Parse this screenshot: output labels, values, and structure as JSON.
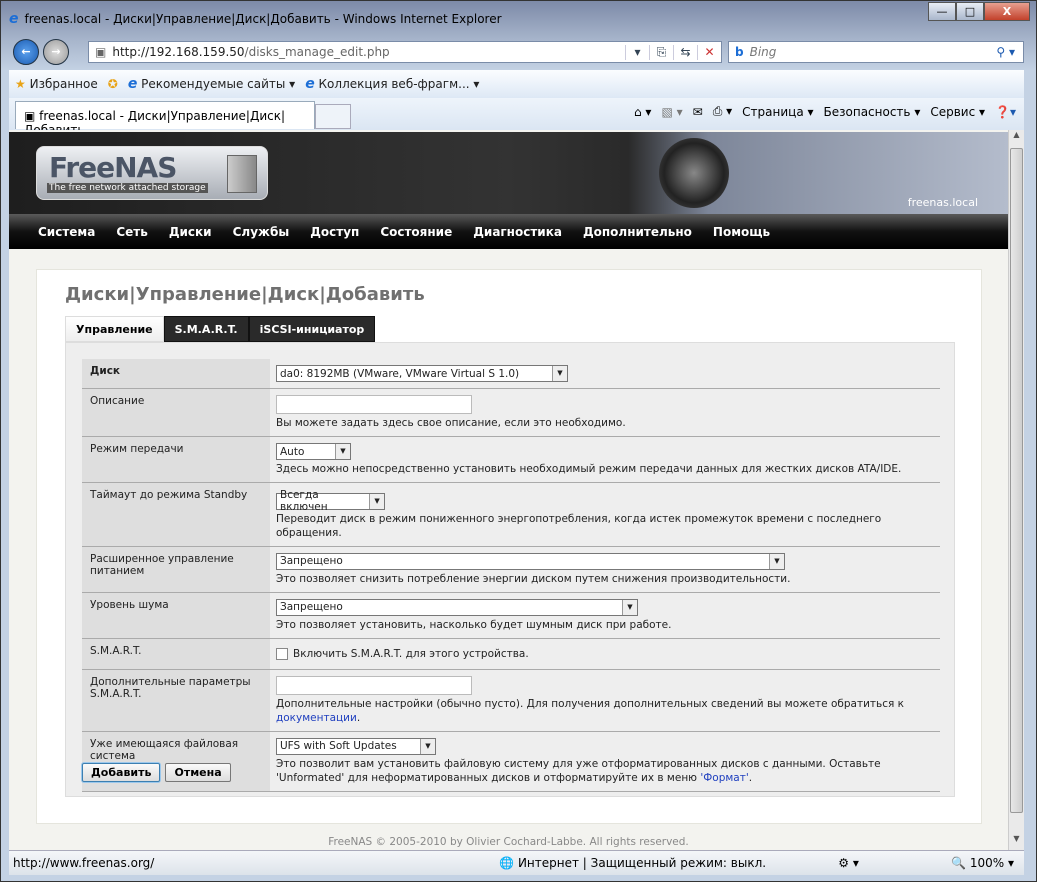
{
  "window": {
    "title": "freenas.local - Диски|Управление|Диск|Добавить - Windows Internet Explorer"
  },
  "browser": {
    "url_host": "http://192.168.159.50",
    "url_path": "/disks_manage_edit.php",
    "search_placeholder": "Bing",
    "favorites_label": "Избранное",
    "fav_links": [
      "Рекомендуемые сайты ▾",
      "Коллекция веб-фрагм... ▾"
    ],
    "tab_title": "freenas.local - Диски|Управление|Диск|Добавить",
    "commands": [
      "Страница ▾",
      "Безопасность ▾",
      "Сервис ▾"
    ]
  },
  "header": {
    "logo_name": "FreeNAS",
    "logo_tagline": "The free network attached storage",
    "hostname": "freenas.local"
  },
  "nav": [
    "Система",
    "Сеть",
    "Диски",
    "Службы",
    "Доступ",
    "Состояние",
    "Диагностика",
    "Дополнительно",
    "Помощь"
  ],
  "page": {
    "title": "Диски|Управление|Диск|Добавить",
    "tabs": [
      "Управление",
      "S.M.A.R.T.",
      "iSCSI-инициатор"
    ]
  },
  "form": {
    "disk": {
      "label": "Диск",
      "value": "da0: 8192MB (VMware, VMware Virtual S 1.0)"
    },
    "description": {
      "label": "Описание",
      "value": "",
      "hint": "Вы можете задать здесь свое описание, если это необходимо."
    },
    "transfer": {
      "label": "Режим передачи",
      "value": "Auto",
      "hint": "Здесь можно непосредственно установить необходимый режим передачи данных для жестких дисков ATA/IDE."
    },
    "standby": {
      "label": "Таймаут до режима Standby",
      "value": "Всегда включен",
      "hint": "Переводит диск в режим пониженного энергопотребления, когда истек промежуток времени с последнего обращения."
    },
    "apm": {
      "label": "Расширенное управление питанием",
      "value": "Запрещено",
      "hint": "Это позволяет снизить потребление энергии диском путем снижения производительности."
    },
    "acoustic": {
      "label": "Уровень шума",
      "value": "Запрещено",
      "hint": "Это позволяет установить, насколько будет шумным диск при работе."
    },
    "smart": {
      "label": "S.M.A.R.T.",
      "checkbox_label": "Включить S.M.A.R.T. для этого устройства.",
      "checked": false
    },
    "smart_extra": {
      "label": "Дополнительные параметры S.M.A.R.T.",
      "value": "",
      "hint": "Дополнительные настройки (обычно пусто). Для получения дополнительных сведений вы можете обратиться к",
      "link": "документации",
      "hint_end": "."
    },
    "fs": {
      "label": "Уже имеющаяся файловая система",
      "value": "UFS with Soft Updates",
      "hint": "Это позволит вам установить файловую систему для уже отформатированных дисков с данными. Оставьте 'Unformated' для неформатированных дисков и отформатируйте их в меню",
      "link": "'Формат'",
      "hint_end": "."
    },
    "add_button": "Добавить",
    "cancel_button": "Отмена"
  },
  "footer": "FreeNAS © 2005-2010 by Olivier Cochard-Labbe. All rights reserved.",
  "statusbar": {
    "url": "http://www.freenas.org/",
    "zone": "Интернет | Защищенный режим: выкл.",
    "zoom": "100%"
  }
}
